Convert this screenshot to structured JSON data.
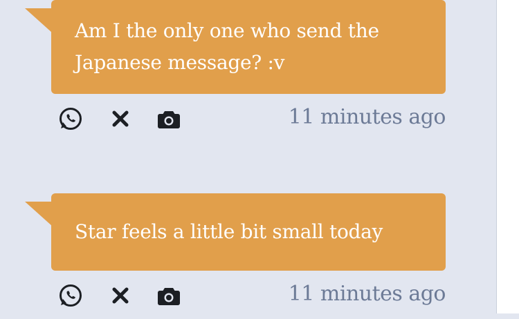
{
  "messages": [
    {
      "text_line1": "Am I the only one who send the",
      "text_line2": "Japanese message? :v",
      "timestamp": "11 minutes ago",
      "actions": [
        "whatsapp-icon",
        "close-icon",
        "camera-icon"
      ]
    },
    {
      "text_line1": "Star feels a little bit small today",
      "timestamp": "11 minutes ago",
      "actions": [
        "whatsapp-icon",
        "close-icon",
        "camera-icon"
      ]
    }
  ],
  "colors": {
    "background": "#e2e6f0",
    "bubble": "#e19f4b",
    "bubble_text": "#ffffff",
    "timestamp": "#6c7a96",
    "icon": "#1c1f24"
  }
}
